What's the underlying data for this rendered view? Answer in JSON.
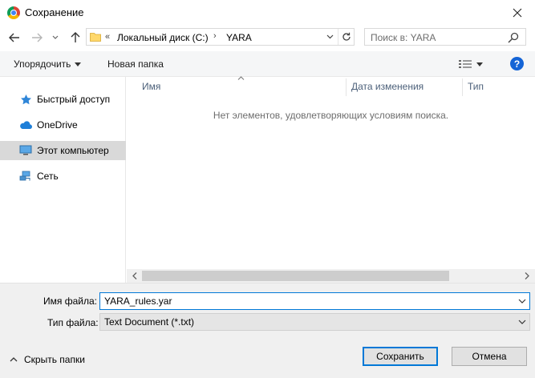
{
  "window": {
    "title": "Сохранение"
  },
  "address": {
    "chevrons": "«",
    "crumbs": [
      "Локальный диск (C:)",
      "YARA"
    ],
    "separator": "›"
  },
  "search": {
    "placeholder": "Поиск в: YARA"
  },
  "toolbar": {
    "organize": "Упорядочить",
    "new_folder": "Новая папка",
    "help": "?"
  },
  "sidebar": {
    "items": [
      {
        "label": "Быстрый доступ",
        "icon": "star-icon",
        "selected": false
      },
      {
        "label": "OneDrive",
        "icon": "cloud-icon",
        "selected": false
      },
      {
        "label": "Этот компьютер",
        "icon": "computer-icon",
        "selected": true
      },
      {
        "label": "Сеть",
        "icon": "network-icon",
        "selected": false
      }
    ]
  },
  "filelist": {
    "columns": [
      "Имя",
      "Дата изменения",
      "Тип"
    ],
    "empty_message": "Нет элементов, удовлетворяющих условиям поиска."
  },
  "form": {
    "filename_label": "Имя файла:",
    "filename_value": "YARA_rules.yar",
    "filetype_label": "Тип файла:",
    "filetype_value": "Text Document (*.txt)"
  },
  "footer": {
    "hide_folders": "Скрыть папки",
    "save": "Сохранить",
    "cancel": "Отмена"
  },
  "colors": {
    "accent": "#0078d7",
    "help": "#1464d6",
    "selected_bg": "#d9d9d9",
    "bottom_bg": "#f0f0f0"
  }
}
